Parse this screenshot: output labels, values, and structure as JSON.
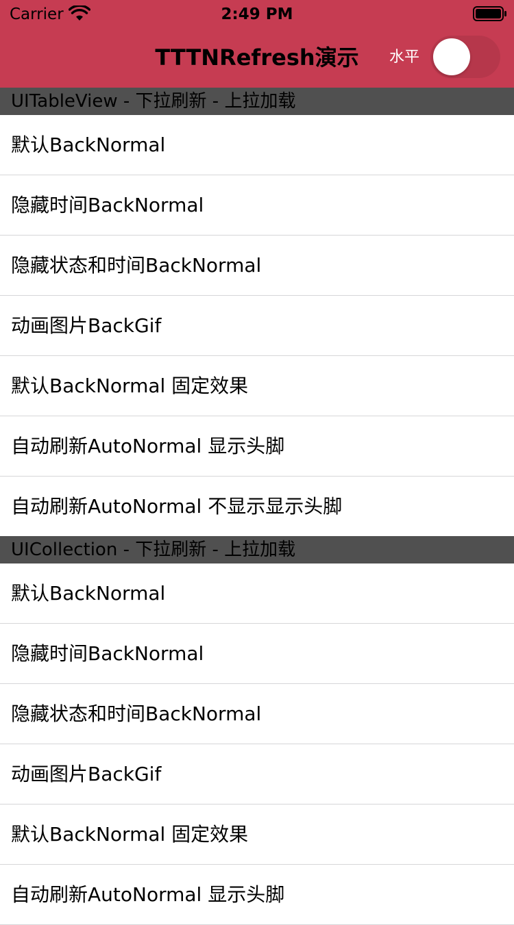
{
  "status_bar": {
    "carrier": "Carrier",
    "time": "2:49 PM",
    "icons": [
      "wifi-icon",
      "battery-icon"
    ]
  },
  "nav": {
    "title": "TTTNRefresh演示",
    "switch_label": "水平",
    "switch_on": false,
    "bar_color": "#C63C52"
  },
  "sections": [
    {
      "header": "UITableView - 下拉刷新 - 上拉加载",
      "items": [
        "默认BackNormal",
        "隐藏时间BackNormal",
        "隐藏状态和时间BackNormal",
        "动画图片BackGif",
        "默认BackNormal 固定效果",
        "自动刷新AutoNormal 显示头脚",
        "自动刷新AutoNormal 不显示显示头脚"
      ]
    },
    {
      "header": "UICollection - 下拉刷新 - 上拉加载",
      "items": [
        "默认BackNormal",
        "隐藏时间BackNormal",
        "隐藏状态和时间BackNormal",
        "动画图片BackGif",
        "默认BackNormal 固定效果",
        "自动刷新AutoNormal 显示头脚"
      ]
    }
  ]
}
